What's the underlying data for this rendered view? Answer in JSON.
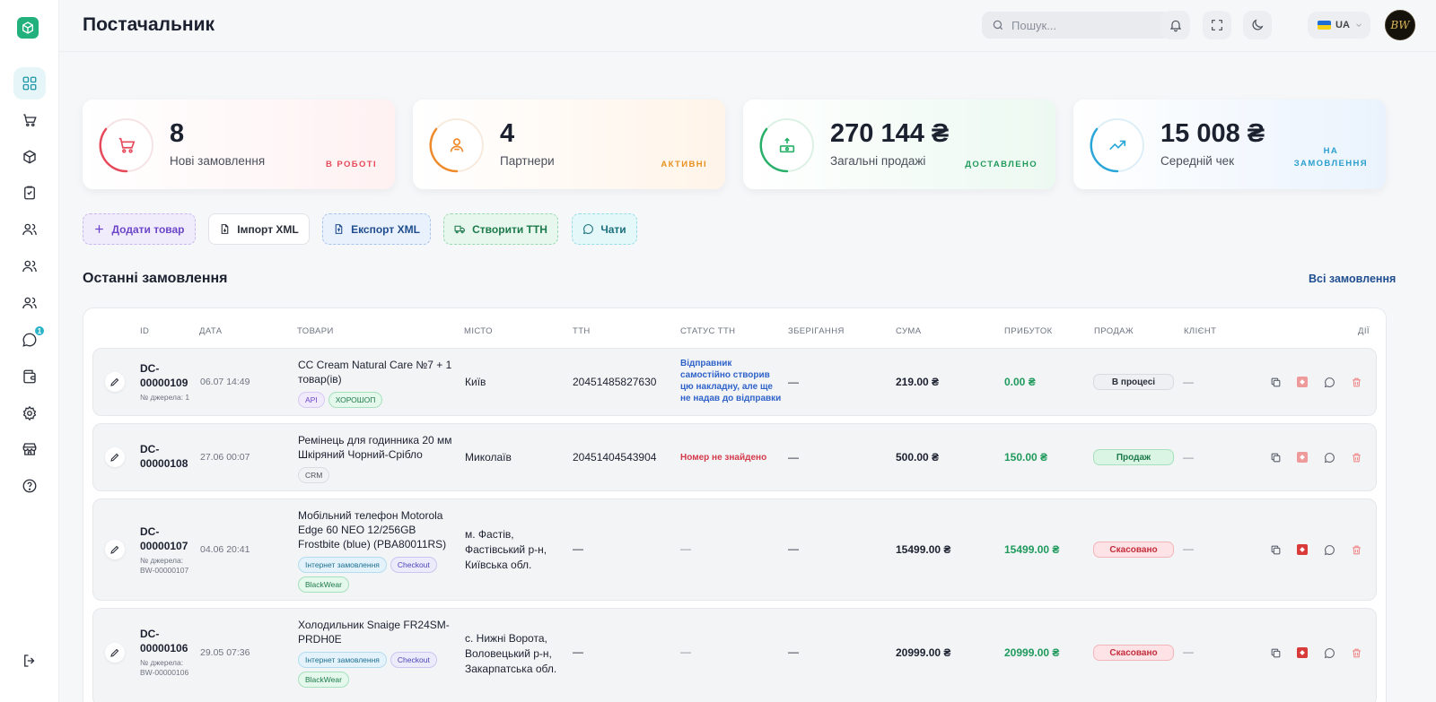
{
  "header": {
    "title": "Постачальник",
    "search_placeholder": "Пошук...",
    "lang": "UA",
    "avatar": "BW"
  },
  "sidebar": {
    "items": [
      {
        "name": "dashboard-icon",
        "active": true
      },
      {
        "name": "cart-icon"
      },
      {
        "name": "box-icon"
      },
      {
        "name": "clipboard-check-icon"
      },
      {
        "name": "users-icon"
      },
      {
        "name": "users-icon"
      },
      {
        "name": "users-icon"
      },
      {
        "name": "chat-icon",
        "badge": "1"
      },
      {
        "name": "wallet-icon"
      },
      {
        "name": "settings-icon"
      },
      {
        "name": "store-icon"
      },
      {
        "name": "help-icon"
      }
    ],
    "logout": "logout-icon"
  },
  "stats": [
    {
      "value": "8",
      "label": "Нові замовлення",
      "tag": "В РОБОТІ",
      "color": "#e64a5a",
      "icon": "cart-icon"
    },
    {
      "value": "4",
      "label": "Партнери",
      "tag": "АКТИВНІ",
      "color": "#ef8a2b",
      "icon": "partner-icon"
    },
    {
      "value": "270 144 ₴",
      "label": "Загальні продажі",
      "tag": "ДОСТАВЛЕНО",
      "color": "#28b06a",
      "icon": "money-icon"
    },
    {
      "value": "15 008 ₴",
      "label": "Середній чек",
      "tag_line1": "НА",
      "tag_line2": "ЗАМОВЛЕННЯ",
      "color": "#2aa6d8",
      "icon": "trend-up-icon"
    }
  ],
  "actions": {
    "add": "Додати товар",
    "import": "Імпорт XML",
    "export": "Експорт XML",
    "ttn": "Створити ТТН",
    "chats": "Чати"
  },
  "orders": {
    "title": "Останні замовлення",
    "all_link": "Всі замовлення",
    "columns": {
      "id": "ID",
      "date": "ДАТА",
      "goods": "ТОВАРИ",
      "city": "МІСТО",
      "ttn": "ТТН",
      "ttn_status": "СТАТУС ТТН",
      "storage": "ЗБЕРІГАННЯ",
      "sum": "СУМА",
      "profit": "ПРИБУТОК",
      "sale": "ПРОДАЖ",
      "client": "КЛІЄНТ",
      "actions": "ДІЇ"
    },
    "rows": [
      {
        "id_line1": "DC-",
        "id_line2": "00000109",
        "source": "№ джерела: 1",
        "date": "06.07 14:49",
        "goods": "CC Cream Natural Care №7 + 1 товар(ів)",
        "tags": [
          "API",
          "ХОРОШОП"
        ],
        "city": "Київ",
        "ttn": "20451485827630",
        "ttn_status": "Відправник самостійно створив цю накладну, але ще не надав до відправки",
        "storage": "—",
        "sum": "219.00 ₴",
        "profit": "0.00 ₴",
        "sale": "В процесі",
        "client": "—"
      },
      {
        "id_line1": "DC-",
        "id_line2": "00000108",
        "source": "",
        "date": "27.06 00:07",
        "goods": "Ремінець для годинника 20 мм Шкіряний Чорний-Срібло",
        "tags": [
          "CRM"
        ],
        "city": "Миколаїв",
        "ttn": "20451404543904",
        "ttn_status": "Номер не знайдено",
        "storage": "—",
        "sum": "500.00 ₴",
        "profit": "150.00 ₴",
        "sale": "Продаж",
        "client": "—"
      },
      {
        "id_line1": "DC-",
        "id_line2": "00000107",
        "source": "№ джерела: BW-00000107",
        "date": "04.06 20:41",
        "goods": "Мобільний телефон Motorola Edge 60 NEO 12/256GB Frostbite (blue) (PBA80011RS)",
        "tags": [
          "Інтернет замовлення",
          "Checkout",
          "BlackWear"
        ],
        "city": "м. Фастів, Фастівський р-н, Київська обл.",
        "ttn": "—",
        "ttn_status": "—",
        "storage": "—",
        "sum": "15499.00 ₴",
        "profit": "15499.00 ₴",
        "sale": "Скасовано",
        "client": "—"
      },
      {
        "id_line1": "DC-",
        "id_line2": "00000106",
        "source": "№ джерела: BW-00000106",
        "date": "29.05 07:36",
        "goods": "Холодильник Snaige FR24SM-PRDH0E",
        "tags": [
          "Інтернет замовлення",
          "Checkout",
          "BlackWear"
        ],
        "city": "с. Нижні Ворота, Воловецький р-н, Закарпатська обл.",
        "ttn": "—",
        "ttn_status": "—",
        "storage": "—",
        "sum": "20999.00 ₴",
        "profit": "20999.00 ₴",
        "sale": "Скасовано",
        "client": "—"
      }
    ]
  }
}
